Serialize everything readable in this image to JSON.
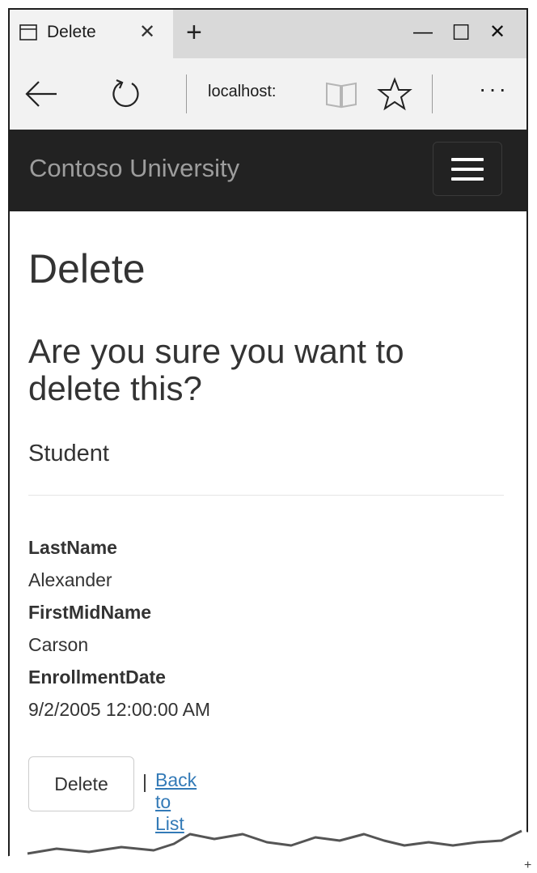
{
  "browser": {
    "tab_title": "Delete",
    "tab_close_glyph": "✕",
    "new_tab_glyph": "+",
    "minimize_glyph": "—",
    "maximize_glyph": "☐",
    "close_glyph": "✕",
    "address": "localhost:",
    "more_glyph": "···",
    "icons": [
      "tab-page-icon",
      "back-arrow-icon",
      "refresh-icon",
      "reading-view-icon",
      "favorite-star-icon"
    ]
  },
  "site": {
    "brand": "Contoso University",
    "menu_icon": "hamburger-icon"
  },
  "page": {
    "title": "Delete",
    "confirm_message": "Are you sure you want to delete this?",
    "entity": "Student",
    "fields": [
      {
        "label": "LastName",
        "value": "Alexander"
      },
      {
        "label": "FirstMidName",
        "value": "Carson"
      },
      {
        "label": "EnrollmentDate",
        "value": "9/2/2005 12:00:00 AM"
      }
    ],
    "delete_button": "Delete",
    "separator": "|",
    "back_link": "Back to List"
  },
  "colors": {
    "navbar_bg": "#222222",
    "brand_text": "#9d9d9d",
    "link": "#337ab7",
    "text": "#333333"
  }
}
